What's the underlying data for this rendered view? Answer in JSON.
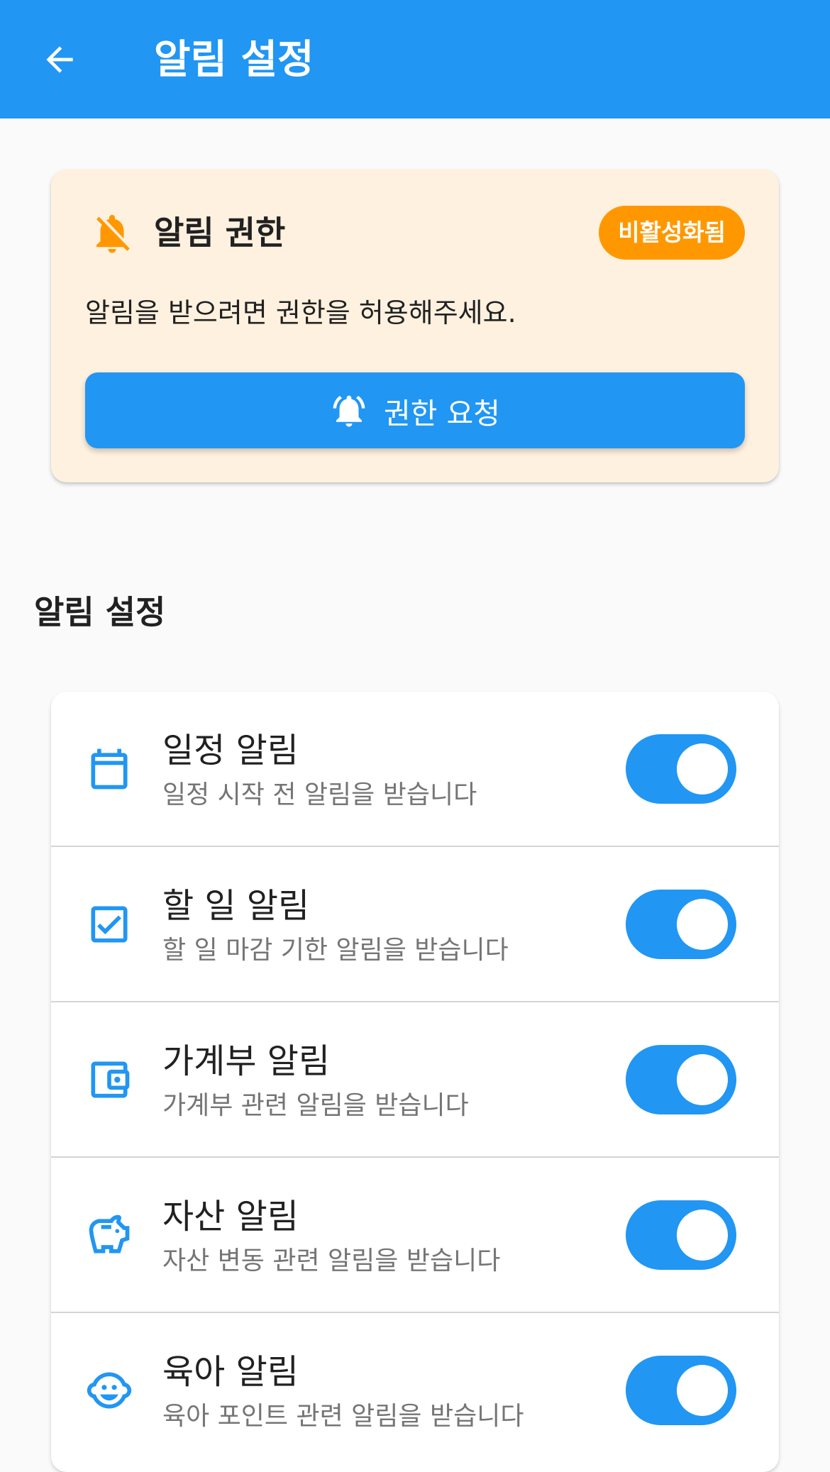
{
  "appbar": {
    "title": "알림 설정",
    "back_icon": "arrow-back-icon",
    "color": "#2196f3"
  },
  "permission": {
    "title": "알림 권한",
    "status_badge": "비활성화됨",
    "description": "알림을 받으려면 권한을 허용해주세요.",
    "request_button": "권한 요청",
    "icon": "notifications-off-icon",
    "button_icon": "notifications-active-icon",
    "card_color": "#fff1df",
    "badge_color": "#ff9800"
  },
  "section": {
    "title": "알림 설정"
  },
  "settings": [
    {
      "title": "일정 알림",
      "subtitle": "일정 시작 전 알림을 받습니다",
      "icon": "calendar-icon",
      "enabled": true
    },
    {
      "title": "할 일 알림",
      "subtitle": "할 일 마감 기한 알림을 받습니다",
      "icon": "checkbox-icon",
      "enabled": true
    },
    {
      "title": "가계부 알림",
      "subtitle": "가계부 관련 알림을 받습니다",
      "icon": "wallet-icon",
      "enabled": true
    },
    {
      "title": "자산 알림",
      "subtitle": "자산 변동 관련 알림을 받습니다",
      "icon": "piggy-bank-icon",
      "enabled": true
    },
    {
      "title": "육아 알림",
      "subtitle": "육아 포인트 관련 알림을 받습니다",
      "icon": "baby-face-icon",
      "enabled": true
    }
  ],
  "colors": {
    "accent": "#2196f3",
    "text_primary": "#212121",
    "text_secondary": "#757575"
  }
}
